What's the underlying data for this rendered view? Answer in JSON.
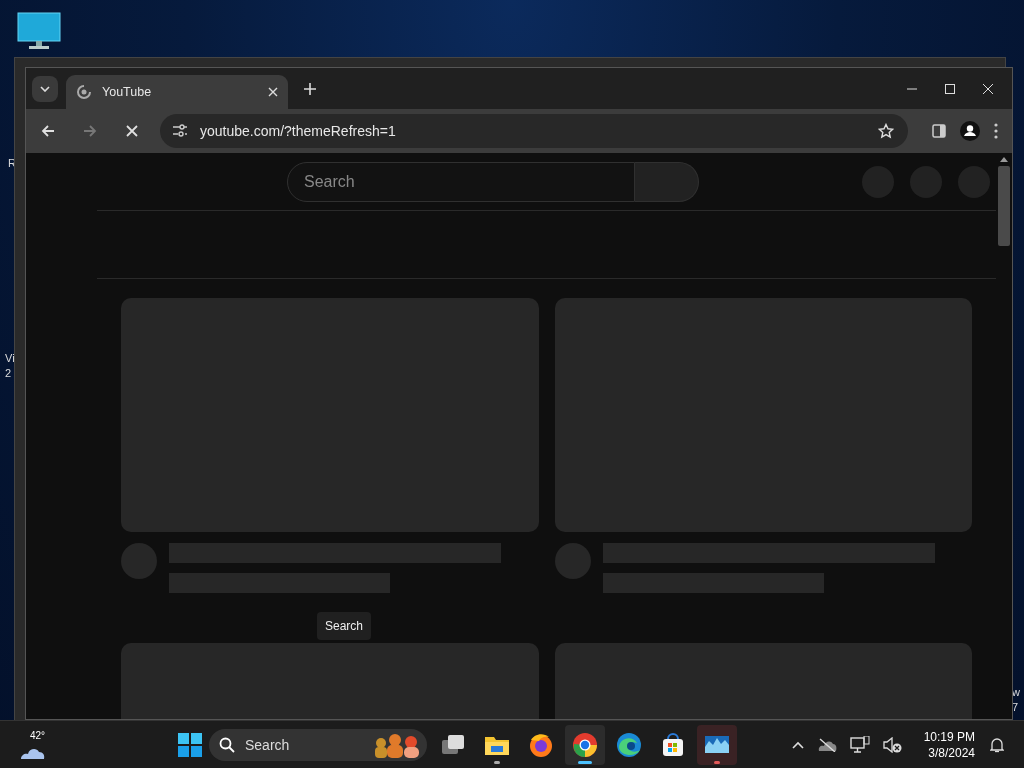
{
  "desktop": {
    "edge_texts": [
      {
        "lines": [
          "R"
        ]
      },
      {
        "lines": [
          "Vi",
          "2"
        ]
      },
      {
        "lines": [
          "w",
          "7"
        ]
      }
    ]
  },
  "browser": {
    "tabs": [
      {
        "title": "YouTube",
        "selected": true
      }
    ],
    "nav_buttons": [
      {
        "kind": "back",
        "disabled": false
      },
      {
        "kind": "forward",
        "disabled": true
      },
      {
        "kind": "stop",
        "disabled": false
      }
    ],
    "address": "youtube.com/?themeRefresh=1",
    "page": {
      "search": {
        "placeholder": "Search"
      },
      "tooltip": "Search",
      "cards": [
        {
          "kind": "video"
        },
        {
          "kind": "video"
        },
        {
          "kind": "video"
        },
        {
          "kind": "video"
        }
      ]
    }
  },
  "taskbar": {
    "weather": {
      "temperature": "42°"
    },
    "search": {
      "placeholder": "Search"
    },
    "apps": [
      {
        "kind": "task-view",
        "running": false,
        "focused": false,
        "attention": false
      },
      {
        "kind": "files",
        "running": true,
        "focused": false,
        "attention": false
      },
      {
        "kind": "firefox",
        "running": false,
        "focused": false,
        "attention": false
      },
      {
        "kind": "chrome",
        "running": true,
        "focused": true,
        "attention": false
      },
      {
        "kind": "edge",
        "running": false,
        "focused": false,
        "attention": false
      },
      {
        "kind": "store",
        "running": false,
        "focused": false,
        "attention": false
      },
      {
        "kind": "monitor",
        "running": true,
        "focused": false,
        "attention": true
      }
    ],
    "clock": {
      "time": "10:19 PM",
      "date": "3/8/2024"
    }
  }
}
